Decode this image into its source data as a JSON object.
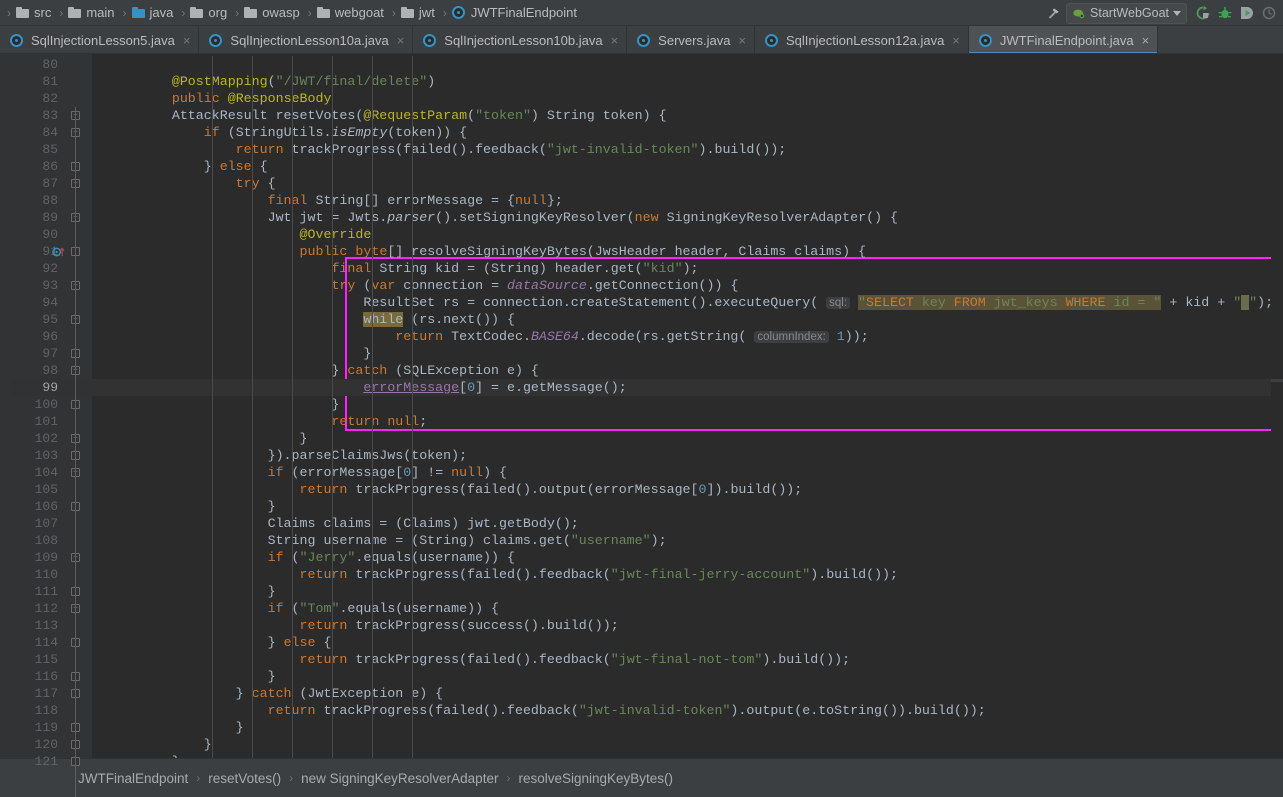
{
  "topbar": {
    "breadcrumbs": [
      {
        "label": "src",
        "icon": "folder-icon"
      },
      {
        "label": "main",
        "icon": "folder-icon"
      },
      {
        "label": "java",
        "icon": "folder-icon-blue"
      },
      {
        "label": "org",
        "icon": "folder-icon"
      },
      {
        "label": "owasp",
        "icon": "folder-icon"
      },
      {
        "label": "webgoat",
        "icon": "folder-icon"
      },
      {
        "label": "jwt",
        "icon": "folder-icon"
      },
      {
        "label": "JWTFinalEndpoint",
        "icon": "java-class-icon"
      }
    ],
    "separator": "›",
    "build_icon": "hammer-icon",
    "run_configuration": "StartWebGoat",
    "run_config_icon": "tomcat-icon",
    "dropdown_icon": "chevron-down-icon",
    "actions": [
      {
        "name": "rerun-icon",
        "glyph": "↻",
        "color": "#499C54"
      },
      {
        "name": "debug-icon",
        "glyph": "⚙",
        "color": "#499C54"
      },
      {
        "name": "run-with-coverage-icon",
        "glyph": "▶",
        "color": "#499C54"
      },
      {
        "name": "profiler-icon",
        "glyph": "◴",
        "color": "#6E6E6E"
      }
    ]
  },
  "tabs": [
    {
      "label": "SqlInjectionLesson5.java",
      "active": false,
      "icon": "java-class-icon",
      "close": "×"
    },
    {
      "label": "SqlInjectionLesson10a.java",
      "active": false,
      "icon": "java-class-icon",
      "close": "×"
    },
    {
      "label": "SqlInjectionLesson10b.java",
      "active": false,
      "icon": "java-class-icon",
      "close": "×"
    },
    {
      "label": "Servers.java",
      "active": false,
      "icon": "java-class-icon",
      "close": "×"
    },
    {
      "label": "SqlInjectionLesson12a.java",
      "active": false,
      "icon": "java-class-icon",
      "close": "×"
    },
    {
      "label": "JWTFinalEndpoint.java",
      "active": true,
      "icon": "java-class-icon",
      "close": "×"
    }
  ],
  "editor": {
    "first_line": 80,
    "last_line": 121,
    "current_line": 99,
    "gutter_icons": [
      {
        "line": 91,
        "name": "implementing-method-icon"
      },
      {
        "line": 99,
        "name": "intention-bulb-icon"
      }
    ],
    "selection_border_color": "#FF22FF",
    "selection_lines": [
      92,
      101
    ],
    "inlay_hints": [
      {
        "line": 94,
        "text": "sql:"
      },
      {
        "line": 96,
        "text": "columnIndex:"
      }
    ],
    "lines": [
      {
        "n": 80,
        "text": ""
      },
      {
        "n": 81,
        "text": "        @PostMapping(\"/JWT/final/delete\")"
      },
      {
        "n": 82,
        "text": "        public @ResponseBody"
      },
      {
        "n": 83,
        "text": "        AttackResult resetVotes(@RequestParam(\"token\") String token) {"
      },
      {
        "n": 84,
        "text": "            if (StringUtils.isEmpty(token)) {"
      },
      {
        "n": 85,
        "text": "                return trackProgress(failed().feedback(\"jwt-invalid-token\").build());"
      },
      {
        "n": 86,
        "text": "            } else {"
      },
      {
        "n": 87,
        "text": "                try {"
      },
      {
        "n": 88,
        "text": "                    final String[] errorMessage = {null};"
      },
      {
        "n": 89,
        "text": "                    Jwt jwt = Jwts.parser().setSigningKeyResolver(new SigningKeyResolverAdapter() {"
      },
      {
        "n": 90,
        "text": "                        @Override"
      },
      {
        "n": 91,
        "text": "                        public byte[] resolveSigningKeyBytes(JwsHeader header, Claims claims) {"
      },
      {
        "n": 92,
        "text": "                            final String kid = (String) header.get(\"kid\");"
      },
      {
        "n": 93,
        "text": "                            try (var connection = dataSource.getConnection()) {"
      },
      {
        "n": 94,
        "text": "                                ResultSet rs = connection.createStatement().executeQuery( sql: \"SELECT key FROM jwt_keys WHERE id = \" + kid + \"\");"
      },
      {
        "n": 95,
        "text": "                                while (rs.next()) {"
      },
      {
        "n": 96,
        "text": "                                    return TextCodec.BASE64.decode(rs.getString( columnIndex: 1));"
      },
      {
        "n": 97,
        "text": "                                }"
      },
      {
        "n": 98,
        "text": "                            } catch (SQLException e) {"
      },
      {
        "n": 99,
        "text": "                                errorMessage[0] = e.getMessage();"
      },
      {
        "n": 100,
        "text": "                            }"
      },
      {
        "n": 101,
        "text": "                            return null;"
      },
      {
        "n": 102,
        "text": "                        }"
      },
      {
        "n": 103,
        "text": "                    }).parseClaimsJws(token);"
      },
      {
        "n": 104,
        "text": "                    if (errorMessage[0] != null) {"
      },
      {
        "n": 105,
        "text": "                        return trackProgress(failed().output(errorMessage[0]).build());"
      },
      {
        "n": 106,
        "text": "                    }"
      },
      {
        "n": 107,
        "text": "                    Claims claims = (Claims) jwt.getBody();"
      },
      {
        "n": 108,
        "text": "                    String username = (String) claims.get(\"username\");"
      },
      {
        "n": 109,
        "text": "                    if (\"Jerry\".equals(username)) {"
      },
      {
        "n": 110,
        "text": "                        return trackProgress(failed().feedback(\"jwt-final-jerry-account\").build());"
      },
      {
        "n": 111,
        "text": "                    }"
      },
      {
        "n": 112,
        "text": "                    if (\"Tom\".equals(username)) {"
      },
      {
        "n": 113,
        "text": "                        return trackProgress(success().build());"
      },
      {
        "n": 114,
        "text": "                    } else {"
      },
      {
        "n": 115,
        "text": "                        return trackProgress(failed().feedback(\"jwt-final-not-tom\").build());"
      },
      {
        "n": 116,
        "text": "                    }"
      },
      {
        "n": 117,
        "text": "                } catch (JwtException e) {"
      },
      {
        "n": 118,
        "text": "                    return trackProgress(failed().feedback(\"jwt-invalid-token\").output(e.toString()).build());"
      },
      {
        "n": 119,
        "text": "                }"
      },
      {
        "n": 120,
        "text": "            }"
      },
      {
        "n": 121,
        "text": "        }"
      }
    ],
    "sql_string_value": "SELECT key FROM jwt_keys WHERE id = "
  },
  "bottombar": {
    "breadcrumbs": [
      "JWTFinalEndpoint",
      "resetVotes()",
      "new SigningKeyResolverAdapter",
      "resolveSigningKeyBytes()"
    ],
    "separator": "›"
  },
  "colors": {
    "background": "#2B2B2B",
    "chrome": "#3C3F41",
    "gutter": "#313335",
    "keyword": "#CC7832",
    "string": "#6A8759",
    "annotation": "#BBB529",
    "number": "#6897BB",
    "field": "#9876AA",
    "default_text": "#A9B7C6",
    "selection_border": "#FF22FF",
    "accent": "#4A88C7",
    "run_green": "#499C54"
  }
}
